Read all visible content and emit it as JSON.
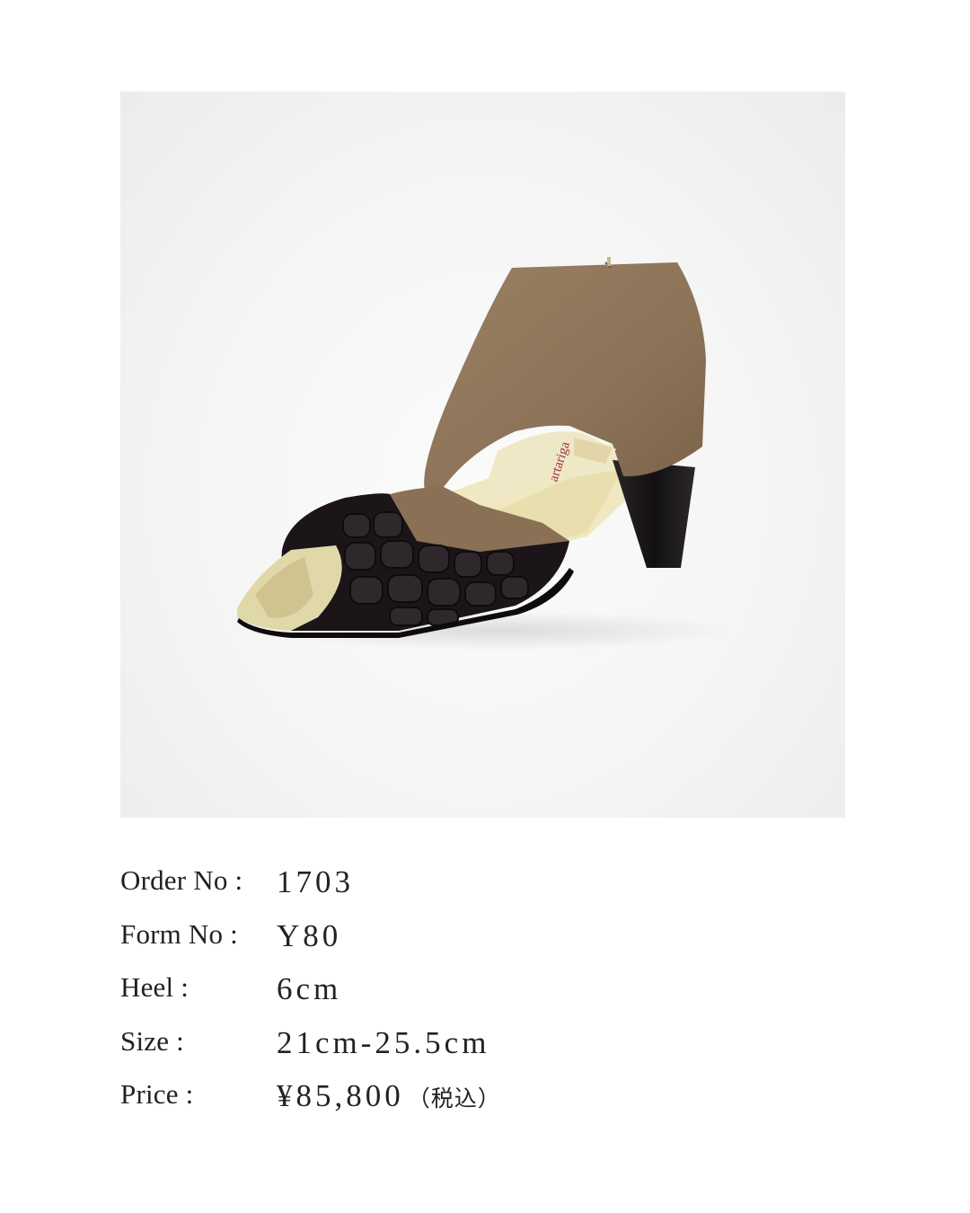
{
  "product": {
    "image_description": "shoe-photo",
    "insole_brand": "artariga"
  },
  "specs": [
    {
      "label": "Order No :",
      "value": "1703"
    },
    {
      "label": "Form No :",
      "value": "Y80"
    },
    {
      "label": "Heel :",
      "value": "6cm"
    },
    {
      "label": "Size :",
      "value": "21cm-25.5cm"
    },
    {
      "label": "Price :",
      "value": "¥85,800",
      "suffix": "（税込）"
    }
  ],
  "colors": {
    "upper_taupe": "#8d7459",
    "toe_black": "#1a1418",
    "heel_black": "#141214",
    "insole_gold": "#d8cfa0",
    "background": "#f4f4f4"
  }
}
